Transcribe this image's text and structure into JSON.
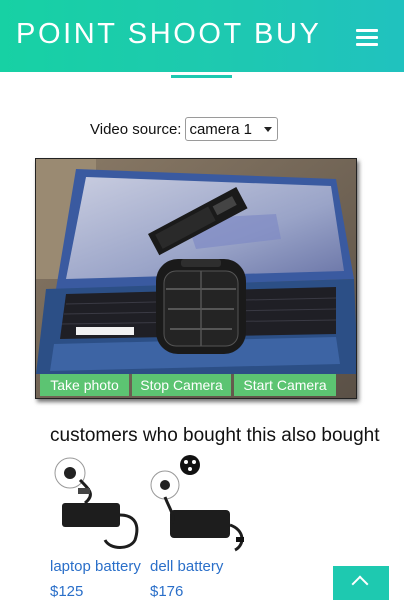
{
  "header": {
    "brand": "POINT SHOOT BUY",
    "menu_icon": "hamburger-menu-icon"
  },
  "video": {
    "label": "Video source:",
    "selected": "camera 1"
  },
  "camera": {
    "buttons": [
      "Take photo",
      "Stop Camera",
      "Start Camera"
    ]
  },
  "recommendations": {
    "title": "customers who bought this also bought",
    "products": [
      {
        "name": "laptop battery",
        "price": "$125"
      },
      {
        "name": "dell battery",
        "price": "$176"
      }
    ]
  },
  "back_to_top_icon": "chevron-up-icon",
  "colors": {
    "accent": "#1ec9b0",
    "button_green": "#5cc472",
    "link": "#2a6fc9"
  }
}
